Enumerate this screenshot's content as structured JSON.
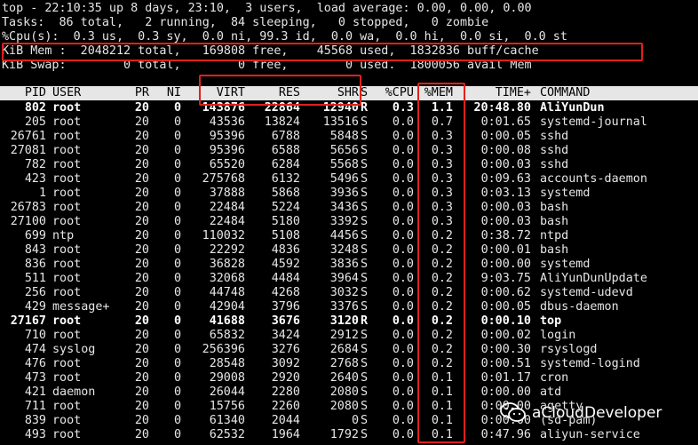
{
  "top_lines": [
    "top - 22:10:35 up 8 days, 23:10,  3 users,  load average: 0.00, 0.00, 0.00",
    "Tasks:  86 total,   2 running,  84 sleeping,   0 stopped,   0 zombie",
    "%Cpu(s):  0.3 us,  0.3 sy,  0.0 ni, 99.3 id,  0.0 wa,  0.0 hi,  0.0 si,  0.0 st",
    "KiB Mem :  2048212 total,   169808 free,    45568 used,  1832836 buff/cache",
    "KiB Swap:        0 total,        0 free,        0 used.  1800056 avail Mem"
  ],
  "columns": [
    "PID",
    "USER",
    "PR",
    "NI",
    "VIRT",
    "RES",
    "SHR",
    "S",
    "%CPU",
    "%MEM",
    "TIME+",
    "COMMAND"
  ],
  "processes": [
    {
      "pid": "802",
      "user": "root",
      "pr": "20",
      "ni": "0",
      "virt": "143876",
      "res": "22864",
      "shr": "12940",
      "s": "R",
      "cpu": "0.3",
      "mem": "1.1",
      "time": "20:48.80",
      "command": "AliYunDun",
      "bold": true
    },
    {
      "pid": "205",
      "user": "root",
      "pr": "20",
      "ni": "0",
      "virt": "43536",
      "res": "13824",
      "shr": "13516",
      "s": "S",
      "cpu": "0.0",
      "mem": "0.7",
      "time": "0:01.65",
      "command": "systemd-journal"
    },
    {
      "pid": "26761",
      "user": "root",
      "pr": "20",
      "ni": "0",
      "virt": "95396",
      "res": "6788",
      "shr": "5848",
      "s": "S",
      "cpu": "0.0",
      "mem": "0.3",
      "time": "0:00.05",
      "command": "sshd"
    },
    {
      "pid": "27081",
      "user": "root",
      "pr": "20",
      "ni": "0",
      "virt": "95396",
      "res": "6588",
      "shr": "5656",
      "s": "S",
      "cpu": "0.0",
      "mem": "0.3",
      "time": "0:00.08",
      "command": "sshd"
    },
    {
      "pid": "782",
      "user": "root",
      "pr": "20",
      "ni": "0",
      "virt": "65520",
      "res": "6284",
      "shr": "5568",
      "s": "S",
      "cpu": "0.0",
      "mem": "0.3",
      "time": "0:00.03",
      "command": "sshd"
    },
    {
      "pid": "423",
      "user": "root",
      "pr": "20",
      "ni": "0",
      "virt": "275768",
      "res": "6132",
      "shr": "5496",
      "s": "S",
      "cpu": "0.0",
      "mem": "0.3",
      "time": "0:09.63",
      "command": "accounts-daemon"
    },
    {
      "pid": "1",
      "user": "root",
      "pr": "20",
      "ni": "0",
      "virt": "37888",
      "res": "5868",
      "shr": "3936",
      "s": "S",
      "cpu": "0.0",
      "mem": "0.3",
      "time": "0:03.13",
      "command": "systemd"
    },
    {
      "pid": "26783",
      "user": "root",
      "pr": "20",
      "ni": "0",
      "virt": "22484",
      "res": "5224",
      "shr": "3436",
      "s": "S",
      "cpu": "0.0",
      "mem": "0.3",
      "time": "0:00.03",
      "command": "bash"
    },
    {
      "pid": "27100",
      "user": "root",
      "pr": "20",
      "ni": "0",
      "virt": "22484",
      "res": "5180",
      "shr": "3392",
      "s": "S",
      "cpu": "0.0",
      "mem": "0.3",
      "time": "0:00.03",
      "command": "bash"
    },
    {
      "pid": "699",
      "user": "ntp",
      "pr": "20",
      "ni": "0",
      "virt": "110032",
      "res": "5108",
      "shr": "4456",
      "s": "S",
      "cpu": "0.0",
      "mem": "0.2",
      "time": "0:38.72",
      "command": "ntpd"
    },
    {
      "pid": "843",
      "user": "root",
      "pr": "20",
      "ni": "0",
      "virt": "22292",
      "res": "4836",
      "shr": "3248",
      "s": "S",
      "cpu": "0.0",
      "mem": "0.2",
      "time": "0:00.01",
      "command": "bash"
    },
    {
      "pid": "836",
      "user": "root",
      "pr": "20",
      "ni": "0",
      "virt": "36828",
      "res": "4592",
      "shr": "3836",
      "s": "S",
      "cpu": "0.0",
      "mem": "0.2",
      "time": "0:00.00",
      "command": "systemd"
    },
    {
      "pid": "511",
      "user": "root",
      "pr": "20",
      "ni": "0",
      "virt": "32068",
      "res": "4484",
      "shr": "3964",
      "s": "S",
      "cpu": "0.0",
      "mem": "0.2",
      "time": "9:03.75",
      "command": "AliYunDunUpdate"
    },
    {
      "pid": "256",
      "user": "root",
      "pr": "20",
      "ni": "0",
      "virt": "44748",
      "res": "4268",
      "shr": "3032",
      "s": "S",
      "cpu": "0.0",
      "mem": "0.2",
      "time": "0:00.62",
      "command": "systemd-udevd"
    },
    {
      "pid": "429",
      "user": "message+",
      "pr": "20",
      "ni": "0",
      "virt": "42904",
      "res": "3796",
      "shr": "3376",
      "s": "S",
      "cpu": "0.0",
      "mem": "0.2",
      "time": "0:00.05",
      "command": "dbus-daemon"
    },
    {
      "pid": "27167",
      "user": "root",
      "pr": "20",
      "ni": "0",
      "virt": "41688",
      "res": "3676",
      "shr": "3120",
      "s": "R",
      "cpu": "0.0",
      "mem": "0.2",
      "time": "0:00.10",
      "command": "top",
      "bold": true
    },
    {
      "pid": "710",
      "user": "root",
      "pr": "20",
      "ni": "0",
      "virt": "65832",
      "res": "3424",
      "shr": "2912",
      "s": "S",
      "cpu": "0.0",
      "mem": "0.2",
      "time": "0:00.02",
      "command": "login"
    },
    {
      "pid": "474",
      "user": "syslog",
      "pr": "20",
      "ni": "0",
      "virt": "256396",
      "res": "3276",
      "shr": "2684",
      "s": "S",
      "cpu": "0.0",
      "mem": "0.2",
      "time": "0:00.30",
      "command": "rsyslogd"
    },
    {
      "pid": "476",
      "user": "root",
      "pr": "20",
      "ni": "0",
      "virt": "28548",
      "res": "3092",
      "shr": "2768",
      "s": "S",
      "cpu": "0.0",
      "mem": "0.2",
      "time": "0:00.51",
      "command": "systemd-logind"
    },
    {
      "pid": "473",
      "user": "root",
      "pr": "20",
      "ni": "0",
      "virt": "29008",
      "res": "2920",
      "shr": "2640",
      "s": "S",
      "cpu": "0.0",
      "mem": "0.1",
      "time": "0:01.17",
      "command": "cron"
    },
    {
      "pid": "421",
      "user": "daemon",
      "pr": "20",
      "ni": "0",
      "virt": "26044",
      "res": "2280",
      "shr": "2080",
      "s": "S",
      "cpu": "0.0",
      "mem": "0.1",
      "time": "0:00.00",
      "command": "atd"
    },
    {
      "pid": "711",
      "user": "root",
      "pr": "20",
      "ni": "0",
      "virt": "15756",
      "res": "2260",
      "shr": "2080",
      "s": "S",
      "cpu": "0.0",
      "mem": "0.1",
      "time": "0:00.00",
      "command": "agetty"
    },
    {
      "pid": "839",
      "user": "root",
      "pr": "20",
      "ni": "0",
      "virt": "61340",
      "res": "2044",
      "shr": "0",
      "s": "S",
      "cpu": "0.0",
      "mem": "0.1",
      "time": "0:00.00",
      "command": "(sd-pam)"
    },
    {
      "pid": "493",
      "user": "root",
      "pr": "20",
      "ni": "0",
      "virt": "62532",
      "res": "1964",
      "shr": "1792",
      "s": "S",
      "cpu": "0.0",
      "mem": "0.1",
      "time": "0:47.96",
      "command": "aliyun-service"
    }
  ],
  "watermark": {
    "text": "aCloudDeveloper",
    "icon": "wechat-icon"
  },
  "highlight_color": "#e0201b"
}
